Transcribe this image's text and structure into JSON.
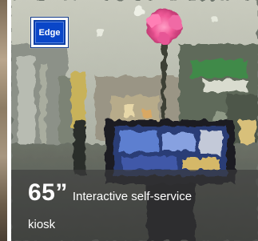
{
  "badge": {
    "label": "Edge",
    "color": "#0b3fa8"
  },
  "caption": {
    "size": "65”",
    "description": "Interactive self-service",
    "continuation": "kiosk"
  }
}
